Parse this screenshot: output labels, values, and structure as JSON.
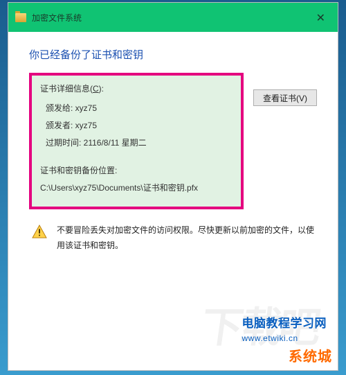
{
  "titlebar": {
    "title": "加密文件系统"
  },
  "heading": "你已经备份了证书和密钥",
  "details": {
    "section_label": "证书详细信息(",
    "section_label_u": "C",
    "section_label_end": "):",
    "issued_to": "颁发给: xyz75",
    "issued_by": "颁发者: xyz75",
    "expires": "过期时间: 2116/8/11 星期二",
    "backup_label": "证书和密钥备份位置:",
    "backup_path": "C:\\Users\\xyz75\\Documents\\证书和密钥.pfx"
  },
  "view_button": "查看证书(V)",
  "warning": "不要冒险丢失对加密文件的访问权限。尽快更新以前加密的文件，以使用该证书和密钥。",
  "watermarks": {
    "line1a": "电脑教程学习网",
    "line1b": "www.etwiki.cn",
    "line2": "系统城",
    "bg": "下载吧"
  }
}
